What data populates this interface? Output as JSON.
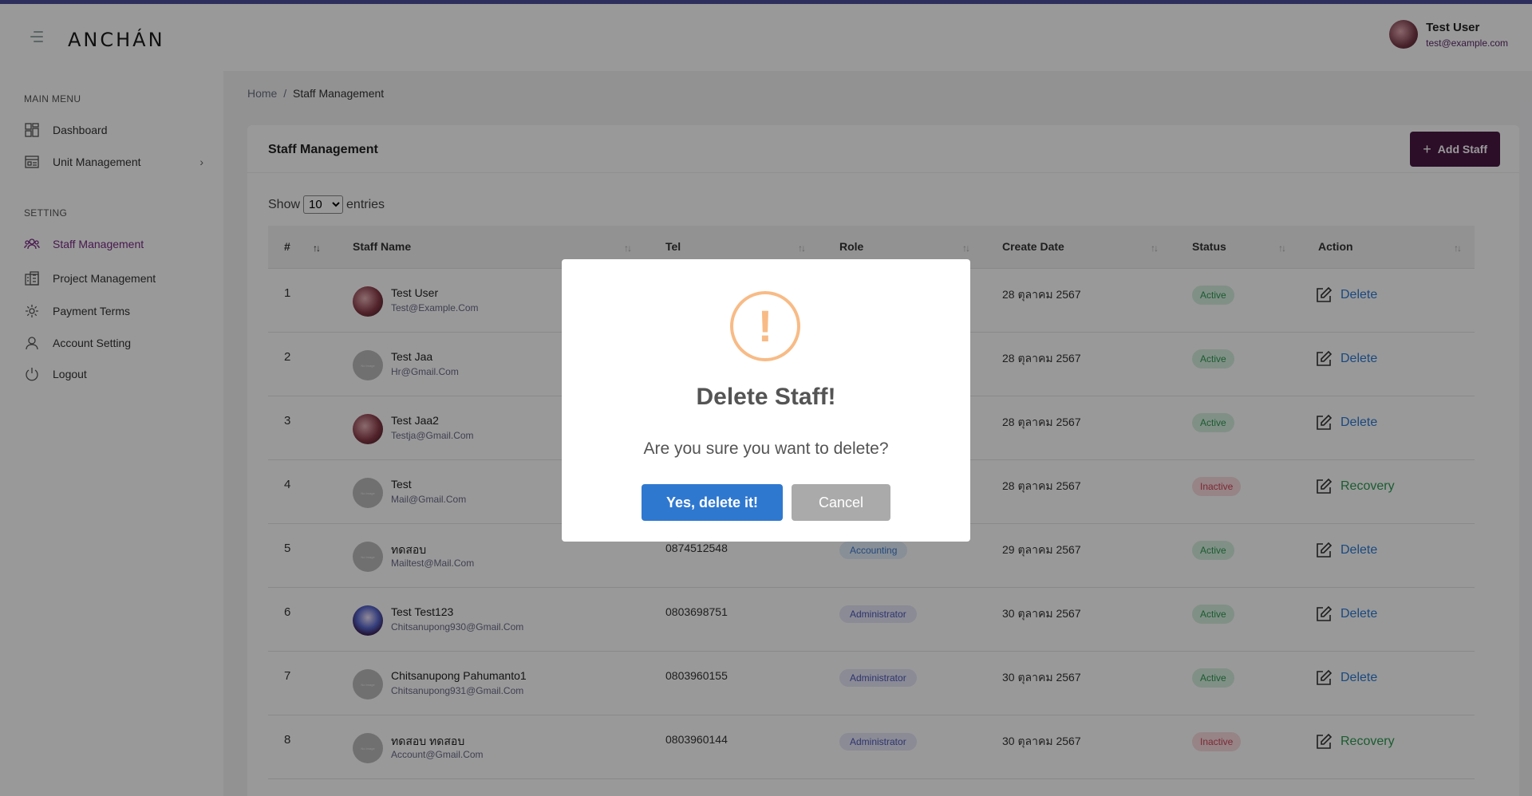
{
  "header": {
    "brand": "ANCHÁN",
    "user_name": "Test User",
    "user_email": "test@example.com"
  },
  "sidebar": {
    "main_menu_label": "MAIN MENU",
    "setting_label": "SETTING",
    "items": [
      {
        "label": "Dashboard",
        "icon": "dashboard-icon"
      },
      {
        "label": "Unit Management",
        "icon": "building-icon"
      },
      {
        "label": "Staff Management",
        "icon": "users-icon"
      },
      {
        "label": "Project Management",
        "icon": "project-icon"
      },
      {
        "label": "Payment Terms",
        "icon": "gear-icon"
      },
      {
        "label": "Account Setting",
        "icon": "user-icon"
      },
      {
        "label": "Logout",
        "icon": "power-icon"
      }
    ]
  },
  "breadcrumb": {
    "home": "Home",
    "separator": "/",
    "current": "Staff Management"
  },
  "card": {
    "title": "Staff Management",
    "add_button": "Add Staff",
    "show_label": "Show",
    "entries_label": "entries",
    "page_size": "10"
  },
  "table": {
    "headers": [
      "#",
      "Staff Name",
      "Tel",
      "Role",
      "Create Date",
      "Status",
      "Action"
    ],
    "rows": [
      {
        "num": "1",
        "name": "Test User",
        "email": "Test@Example.Com",
        "tel": "",
        "role": "",
        "date": "28 ตุลาคม 2567",
        "status": "Active",
        "action": "Delete"
      },
      {
        "num": "2",
        "name": "Test Jaa",
        "email": "Hr@Gmail.Com",
        "tel": "",
        "role": "",
        "date": "28 ตุลาคม 2567",
        "status": "Active",
        "action": "Delete"
      },
      {
        "num": "3",
        "name": "Test Jaa2",
        "email": "Testja@Gmail.Com",
        "tel": "",
        "role": "",
        "date": "28 ตุลาคม 2567",
        "status": "Active",
        "action": "Delete"
      },
      {
        "num": "4",
        "name": "Test",
        "email": "Mail@Gmail.Com",
        "tel": "",
        "role": "",
        "date": "28 ตุลาคม 2567",
        "status": "Inactive",
        "action": "Recovery"
      },
      {
        "num": "5",
        "name": "ทดสอบ",
        "email": "Mailtest@Mail.Com",
        "tel": "0874512548",
        "role": "Accounting",
        "date": "29 ตุลาคม 2567",
        "status": "Active",
        "action": "Delete"
      },
      {
        "num": "6",
        "name": "Test Test123",
        "email": "Chitsanupong930@Gmail.Com",
        "tel": "0803698751",
        "role": "Administrator",
        "date": "30 ตุลาคม 2567",
        "status": "Active",
        "action": "Delete"
      },
      {
        "num": "7",
        "name": "Chitsanupong Pahumanto1",
        "email": "Chitsanupong931@Gmail.Com",
        "tel": "0803960155",
        "role": "Administrator",
        "date": "30 ตุลาคม 2567",
        "status": "Active",
        "action": "Delete"
      },
      {
        "num": "8",
        "name": "ทดสอบ ทดสอบ",
        "email": "Account@Gmail.Com",
        "tel": "0803960144",
        "role": "Administrator",
        "date": "30 ตุลาคม 2567",
        "status": "Inactive",
        "action": "Recovery"
      }
    ]
  },
  "modal": {
    "icon": "!",
    "title": "Delete Staff!",
    "text": "Are you sure you want to delete?",
    "confirm": "Yes, delete it!",
    "cancel": "Cancel"
  },
  "colors": {
    "accent": "#7a2a86",
    "primary_button": "#4a1845",
    "confirm_button": "#2f78d0",
    "warning": "#f8bb86",
    "active": "#2d9a52",
    "inactive": "#d04556"
  }
}
